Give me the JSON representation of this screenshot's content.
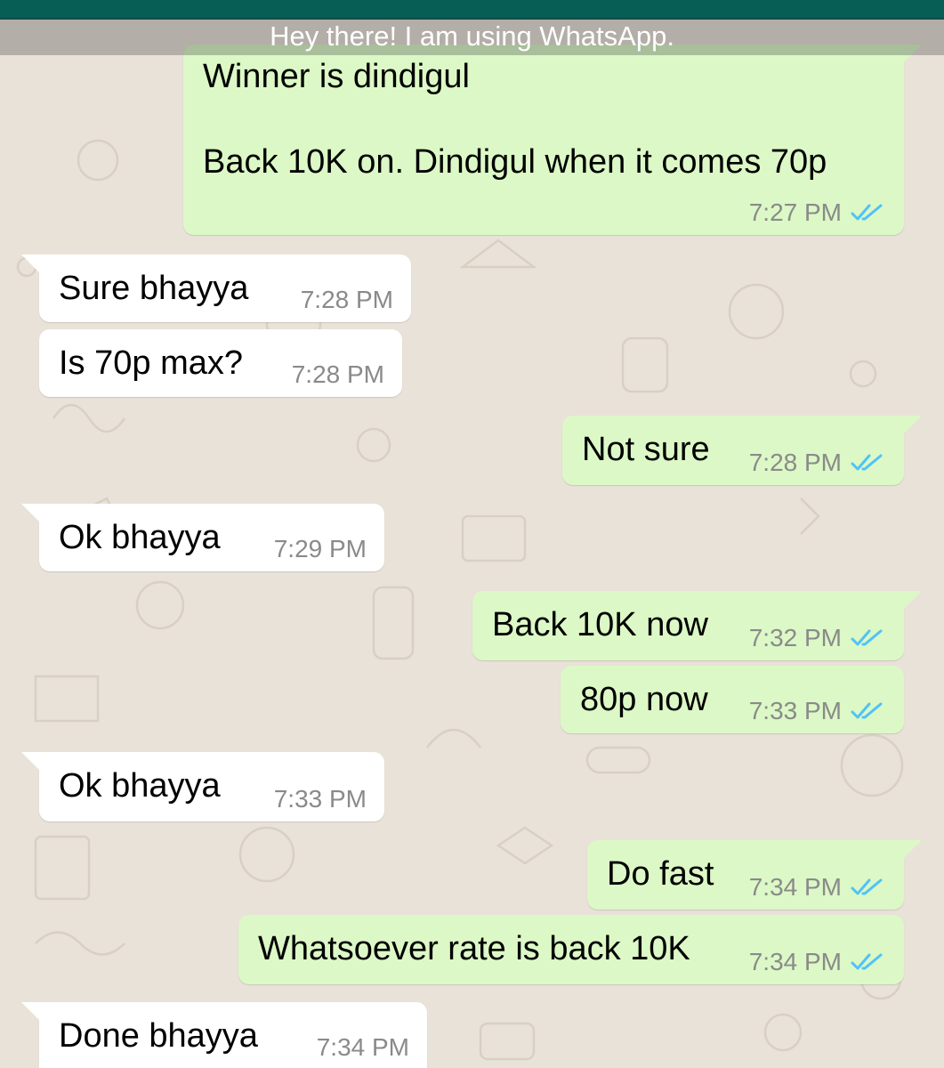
{
  "status_banner": "Hey there! I am using WhatsApp.",
  "colors": {
    "header": "#075e54",
    "outgoing_bubble": "#dcf8c6",
    "incoming_bubble": "#ffffff",
    "read_ticks": "#4fc3f7",
    "timestamp": "#8a8a8a"
  },
  "icons": {
    "read_receipt": "double-check-icon"
  },
  "messages": [
    {
      "dir": "out",
      "lines": [
        "Winner is dindigul",
        "",
        "Back 10K on. Dindigul when it comes 70p"
      ],
      "time": "7:27 PM",
      "read": true
    },
    {
      "dir": "in",
      "text": "Sure bhayya",
      "time": "7:28 PM"
    },
    {
      "dir": "in",
      "text": "Is 70p max?",
      "time": "7:28 PM"
    },
    {
      "dir": "out",
      "text": "Not sure",
      "time": "7:28 PM",
      "read": true
    },
    {
      "dir": "in",
      "text": "Ok bhayya",
      "time": "7:29 PM"
    },
    {
      "dir": "out",
      "text": "Back 10K now",
      "time": "7:32 PM",
      "read": true
    },
    {
      "dir": "out",
      "text": "80p now",
      "time": "7:33 PM",
      "read": true
    },
    {
      "dir": "in",
      "text": "Ok bhayya",
      "time": "7:33 PM"
    },
    {
      "dir": "out",
      "text": "Do fast",
      "time": "7:34 PM",
      "read": true
    },
    {
      "dir": "out",
      "text": "Whatsoever rate is back 10K",
      "time": "7:34 PM",
      "read": true
    },
    {
      "dir": "in",
      "text": "Done bhayya",
      "time": "7:34 PM"
    }
  ]
}
